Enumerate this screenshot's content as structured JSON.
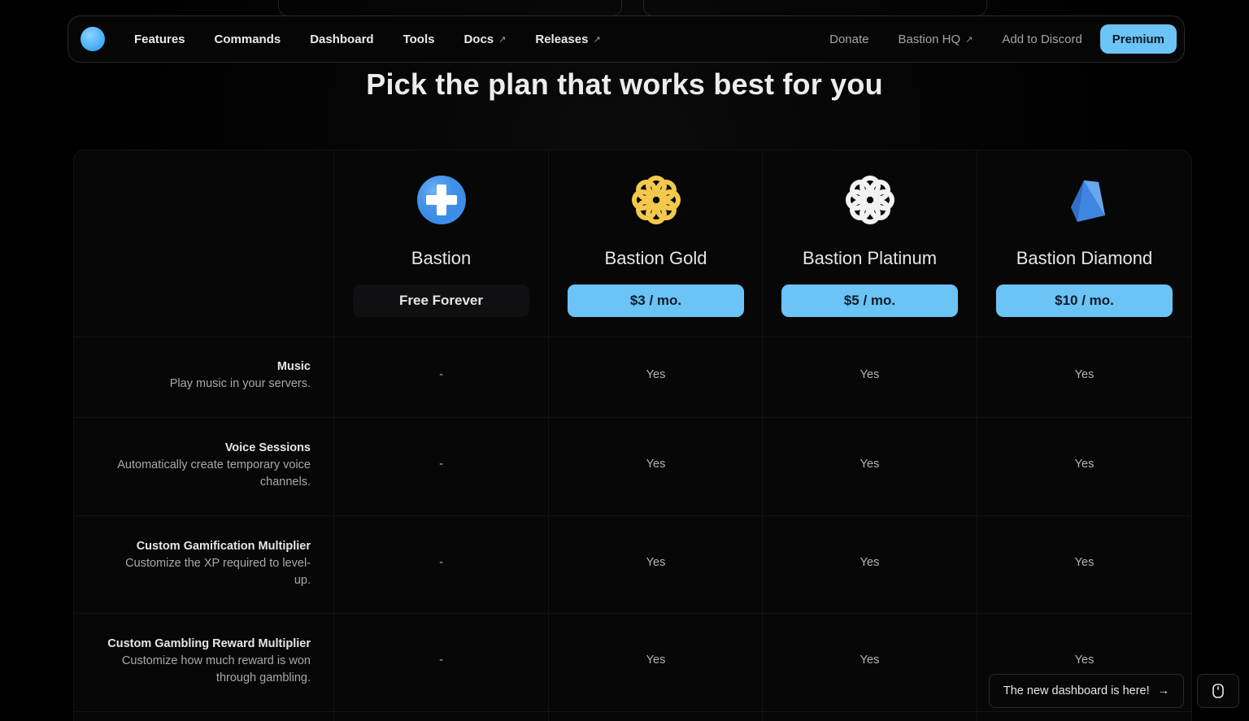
{
  "nav": {
    "items": [
      {
        "label": "Features",
        "external": false
      },
      {
        "label": "Commands",
        "external": false
      },
      {
        "label": "Dashboard",
        "external": false
      },
      {
        "label": "Tools",
        "external": false
      },
      {
        "label": "Docs",
        "external": true
      },
      {
        "label": "Releases",
        "external": true
      }
    ],
    "right_items": [
      {
        "label": "Donate",
        "external": false
      },
      {
        "label": "Bastion HQ",
        "external": true
      },
      {
        "label": "Add to Discord",
        "external": false
      }
    ],
    "premium_label": "Premium",
    "external_glyph": "↗"
  },
  "heading": "Pick the plan that works best for you",
  "plans": [
    {
      "name": "Bastion",
      "price": "Free Forever",
      "icon": "plus-icon",
      "color": "#3d8ee8"
    },
    {
      "name": "Bastion Gold",
      "price": "$3 / mo.",
      "icon": "gold-flower-icon",
      "color": "#f2c94c"
    },
    {
      "name": "Bastion Platinum",
      "price": "$5 / mo.",
      "icon": "platinum-flower-icon",
      "color": "#f2f2f2"
    },
    {
      "name": "Bastion Diamond",
      "price": "$10 / mo.",
      "icon": "diamond-icon",
      "color": "#3f86e0"
    }
  ],
  "features": [
    {
      "title": "Music",
      "desc": "Play music in your servers.",
      "values": [
        "-",
        "Yes",
        "Yes",
        "Yes"
      ]
    },
    {
      "title": "Voice Sessions",
      "desc": "Automatically create temporary voice channels.",
      "values": [
        "-",
        "Yes",
        "Yes",
        "Yes"
      ]
    },
    {
      "title": "Custom Gamification Multiplier",
      "desc": "Customize the XP required to level-up.",
      "values": [
        "-",
        "Yes",
        "Yes",
        "Yes"
      ]
    },
    {
      "title": "Custom Gambling Reward Multiplier",
      "desc": "Customize how much reward is won through gambling.",
      "values": [
        "-",
        "Yes",
        "Yes",
        "Yes"
      ]
    }
  ],
  "toast": {
    "label": "The new dashboard is here!",
    "arrow": "→"
  },
  "colors": {
    "accent": "#6cc3f5",
    "background": "#000000"
  }
}
